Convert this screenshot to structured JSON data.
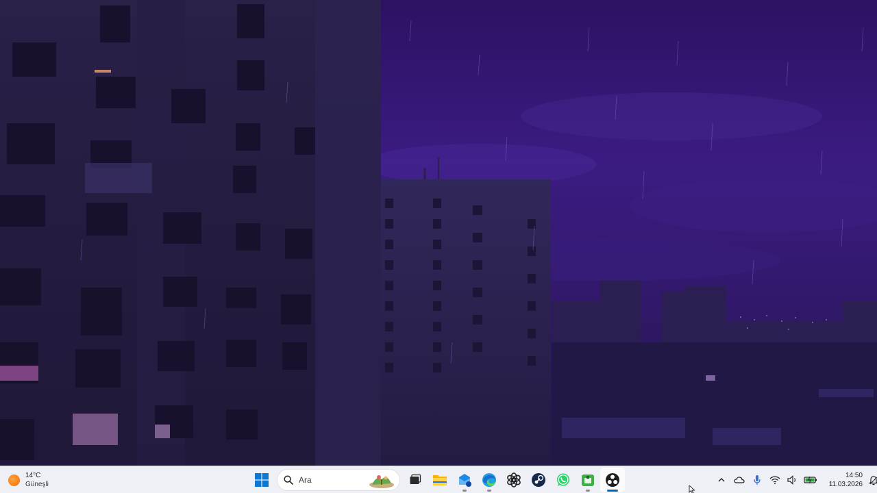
{
  "weather": {
    "temperature": "14°C",
    "condition": "Güneşli",
    "icon": "sun-icon"
  },
  "search": {
    "placeholder": "Ara"
  },
  "taskbar_apps": [
    {
      "name": "start",
      "icon": "windows-logo-icon"
    },
    {
      "name": "search",
      "icon": "search-icon"
    },
    {
      "name": "task-view",
      "icon": "task-view-icon"
    },
    {
      "name": "file-explorer",
      "icon": "folder-icon"
    },
    {
      "name": "mail",
      "icon": "mail-icon"
    },
    {
      "name": "edge",
      "icon": "edge-icon"
    },
    {
      "name": "chatgpt",
      "icon": "chatgpt-icon"
    },
    {
      "name": "steam",
      "icon": "steam-icon"
    },
    {
      "name": "whatsapp",
      "icon": "whatsapp-icon"
    },
    {
      "name": "green-app",
      "icon": "green-box-icon"
    },
    {
      "name": "obs",
      "icon": "obs-icon"
    }
  ],
  "tray": {
    "icons": [
      "chevron-up-icon",
      "cloud-icon",
      "microphone-icon",
      "wifi-icon",
      "speaker-icon",
      "battery-icon"
    ],
    "time": "14:50",
    "date": "11.03.2026"
  },
  "colors": {
    "taskbar": "#eef0f5",
    "sky": "#3a1a7a",
    "accent": "#0067c0"
  }
}
